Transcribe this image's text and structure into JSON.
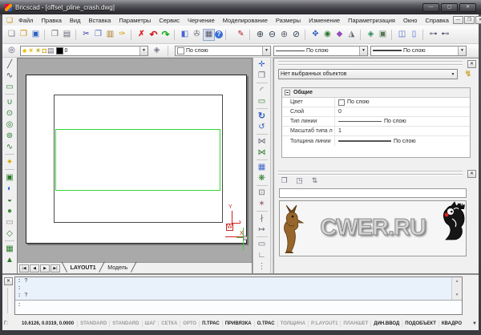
{
  "window": {
    "title": "Bricscad - [offset_pline_crash.dwg]",
    "buttons": [
      {
        "n": "minimize-button",
        "g": "—"
      },
      {
        "n": "maximize-button",
        "g": "▢"
      },
      {
        "n": "close-button",
        "g": "✕"
      }
    ]
  },
  "menu": {
    "items": [
      "Файл",
      "Правка",
      "Вид",
      "Вставка",
      "Параметры",
      "Сервис",
      "Черчение",
      "Моделирование",
      "Размеры",
      "Изменение",
      "Параметризация",
      "Окно",
      "Справка"
    ],
    "doc_icon": "❏",
    "mdi": [
      {
        "n": "mdi-minimize-button",
        "g": "—"
      },
      {
        "n": "mdi-restore-button",
        "g": "❐"
      },
      {
        "n": "mdi-close-button",
        "g": "✕"
      }
    ]
  },
  "toolbar1": {
    "icons": [
      {
        "n": "new-file-icon",
        "g": "❏",
        "s": "color:#778"
      },
      {
        "n": "open-file-icon",
        "g": "❒",
        "s": "color:#c88a00"
      },
      {
        "n": "save-icon",
        "g": "▣",
        "s": "color:#2f5fc0"
      },
      {
        "n": "separator",
        "g": "",
        "s": "width:3px;height:13px;border-left:1px solid #c6c6c6;margin:0 3px"
      },
      {
        "n": "print-preview-icon",
        "g": "❐",
        "s": "color:#667"
      },
      {
        "n": "print-icon",
        "g": "▤",
        "s": "color:#667"
      },
      {
        "n": "separator",
        "g": "",
        "s": "width:3px;height:13px;border-left:1px solid #c6c6c6;margin:0 3px"
      },
      {
        "n": "cut-icon",
        "g": "✂",
        "s": "color:#33a"
      },
      {
        "n": "copy-icon",
        "g": "❐",
        "s": "color:#46c"
      },
      {
        "n": "paste-icon",
        "g": "▥",
        "s": "color:#a72"
      },
      {
        "n": "format-brush-icon",
        "g": "✑",
        "s": "color:#c8a000"
      },
      {
        "n": "separator",
        "g": "",
        "s": "width:3px;height:13px;border-left:1px solid #c6c6c6;margin:0 3px"
      },
      {
        "n": "delete-icon",
        "g": "✗",
        "s": "color:#d22;font-weight:bold"
      },
      {
        "n": "undo-icon",
        "g": "↶",
        "s": "color:#c11;font-weight:bold;font-size:12px"
      },
      {
        "n": "redo-icon",
        "g": "↷",
        "s": "color:#1a1;font-weight:bold;font-size:12px"
      },
      {
        "n": "separator",
        "g": "",
        "s": "width:3px;height:13px;border-left:1px solid #c6c6c6;margin:0 3px"
      },
      {
        "n": "drawing-explorer-icon",
        "g": "◧",
        "s": "color:#46c"
      },
      {
        "n": "settings-icon",
        "g": "✇",
        "s": "color:#667"
      },
      {
        "n": "calculator-icon",
        "g": "▦",
        "s": "color:#556;background:#d9e2f1;border:1px solid #93a7c7"
      },
      {
        "n": "help-icon",
        "g": "?",
        "s": "background:#3a6fd8;color:#fff;border-radius:50%;width:10px;height:10px;line-height:10px;font-size:8px;font-weight:bold;flex:none;display:block;text-align:center"
      },
      {
        "n": "separator",
        "g": "",
        "s": "width:9px;height:13px;border-left:1px solid #c6c6c6;margin:0 3px"
      },
      {
        "n": "redline-icon",
        "g": "✎",
        "s": "color:#b22"
      },
      {
        "n": "separator",
        "g": "",
        "s": "width:3px;height:13px;border-left:1px solid #c6c6c6;margin:0 3px"
      },
      {
        "n": "zoom-in-icon",
        "g": "⊕",
        "s": "color:#345;font-size:11px"
      },
      {
        "n": "zoom-out-icon",
        "g": "⊖",
        "s": "color:#345;font-size:11px"
      },
      {
        "n": "zoom-window-icon",
        "g": "⊕",
        "s": "color:#667;font-size:11px"
      },
      {
        "n": "zoom-previous-icon",
        "g": "⊘",
        "s": "color:#345;font-size:11px"
      },
      {
        "n": "separator",
        "g": "",
        "s": "width:3px;height:13px;border-left:1px solid #c6c6c6;margin:0 3px"
      },
      {
        "n": "pan-icon",
        "g": "✥",
        "s": "color:#2f5fc0"
      },
      {
        "n": "realtime-view-icon",
        "g": "◉",
        "s": "color:#2a7a2a"
      },
      {
        "n": "render-icon",
        "g": "◆",
        "s": "color:#964bb8"
      },
      {
        "n": "shade-icon",
        "g": "◮",
        "s": "color:#667"
      },
      {
        "n": "separator",
        "g": "",
        "s": "width:3px;height:13px;border-left:1px solid #c6c6c6;margin:0 3px"
      },
      {
        "n": "ucs-icon",
        "g": "◈",
        "s": "color:#2a8a5a"
      },
      {
        "n": "named-views-icon",
        "g": "▣",
        "s": "color:#575"
      },
      {
        "n": "separator",
        "g": "",
        "s": "width:3px;height:13px;border-left:1px solid #c6c6c6;margin:0 3px"
      },
      {
        "n": "split-window-icon",
        "g": "◫",
        "s": "color:#46c"
      },
      {
        "n": "single-window-icon",
        "g": "▯",
        "s": "color:#46c"
      },
      {
        "n": "separator",
        "g": "",
        "s": "width:3px;height:13px;border-left:1px solid #c6c6c6;margin:0 3px"
      },
      {
        "n": "link-icon",
        "g": "⊶",
        "s": "color:#557"
      },
      {
        "n": "unlink-icon",
        "g": "⊷",
        "s": "color:#557"
      }
    ]
  },
  "toolbar2": {
    "layer_explorer_icon": "◎",
    "layer_combo": {
      "value": "0",
      "icons": [
        {
          "n": "layer-on-icon",
          "g": "●",
          "s": "color:#f5c400;text-shadow:0 0 1px #a87800"
        },
        {
          "n": "layer-freeze-icon",
          "g": "☀",
          "s": "color:#e0b400"
        },
        {
          "n": "layer-freeze-vp-icon",
          "g": "☀",
          "s": "color:#b0a000"
        },
        {
          "n": "layer-lock-icon",
          "g": "◘",
          "s": "color:#c9a00a"
        },
        {
          "n": "layer-print-icon",
          "g": "▤",
          "s": "color:#667"
        }
      ]
    },
    "layers_manager_icon": "◈",
    "color_combo": {
      "value": "По слою"
    },
    "linetype_combo": {
      "value": "По слою"
    },
    "lineweight_combo": {
      "value": "По слою"
    }
  },
  "left_toolbar": {
    "icons": [
      {
        "n": "line-tool-icon",
        "g": "╱",
        "s": "color:#444"
      },
      {
        "n": "arc-tool-icon",
        "g": "∿",
        "s": "color:#444"
      },
      {
        "n": "polyline-tool-icon",
        "g": "▭",
        "s": "color:#2a7a2a"
      },
      {
        "n": "separator",
        "g": "",
        "s": "width:12px;height:3px;border-top:1px solid #c6c6c6;margin:1px 0"
      },
      {
        "n": "curve-tool-icon",
        "g": "∪",
        "s": "color:#2a7a2a"
      },
      {
        "n": "circle-tool-icon",
        "g": "⊙",
        "s": "color:#2a7a2a"
      },
      {
        "n": "donut-tool-icon",
        "g": "◎",
        "s": "color:#2a7a2a"
      },
      {
        "n": "ellipse-tool-icon",
        "g": "⊚",
        "s": "color:#2a7a2a"
      },
      {
        "n": "spline-tool-icon",
        "g": "∿",
        "s": "color:#2a7a2a"
      },
      {
        "n": "separator",
        "g": "",
        "s": "width:12px;height:3px;border-top:1px solid #c6c6c6;margin:1px 0"
      },
      {
        "n": "point-tool-icon",
        "g": "✦",
        "s": "color:#d4a800"
      },
      {
        "n": "separator",
        "g": "",
        "s": "width:12px;height:3px;border-top:1px solid #c6c6c6;margin:1px 0"
      },
      {
        "n": "box-tool-icon",
        "g": "▣",
        "s": "color:#2a7a2a"
      },
      {
        "n": "sphere-tool-icon",
        "g": "◐",
        "s": "color:#36c"
      },
      {
        "n": "wedge-tool-icon",
        "g": "◒",
        "s": "color:#2a7a2a"
      },
      {
        "n": "cloud-tool-icon",
        "g": "●",
        "s": "color:#3a8a3a"
      },
      {
        "n": "boundary-tool-icon",
        "g": "▭",
        "s": "color:#888"
      },
      {
        "n": "polygon-tool-icon",
        "g": "◇",
        "s": "color:#2a7a2a"
      },
      {
        "n": "separator",
        "g": "",
        "s": "width:12px;height:3px;border-top:1px solid #c6c6c6;margin:1px 0"
      },
      {
        "n": "table-tool-icon",
        "g": "▦",
        "s": "color:#2a7a2a"
      },
      {
        "n": "triangle-tool-icon",
        "g": "▲",
        "s": "color:#2a7a2a"
      }
    ]
  },
  "right_toolbar": {
    "icons": [
      {
        "n": "move-icon",
        "g": "✛",
        "s": "color:#2f5fc0"
      },
      {
        "n": "copy-object-icon",
        "g": "❐",
        "s": "color:#667"
      },
      {
        "n": "separator",
        "g": "",
        "s": "width:14px;height:2px;border-top:1px solid #c6c6c6;margin:1px 0"
      },
      {
        "n": "fillet-icon",
        "g": "◜",
        "s": "color:#667;font-size:11px"
      },
      {
        "n": "chamfer-icon",
        "g": "▭",
        "s": "color:#2a7a2a"
      },
      {
        "n": "separator",
        "g": "",
        "s": "width:14px;height:2px;border-top:1px solid #c6c6c6;margin:1px 0"
      },
      {
        "n": "rotate-icon",
        "g": "↻",
        "s": "color:#2f5fc0;font-size:11px;font-weight:bold"
      },
      {
        "n": "rotate-ref-icon",
        "g": "↺",
        "s": "color:#2f5fc0"
      },
      {
        "n": "separator",
        "g": "",
        "s": "width:14px;height:2px;border-top:1px solid #c6c6c6;margin:1px 0"
      },
      {
        "n": "mirror-icon",
        "g": "⋈",
        "s": "color:#667"
      },
      {
        "n": "mirror-3d-icon",
        "g": "⋈",
        "s": "color:#2a7a2a"
      },
      {
        "n": "separator",
        "g": "",
        "s": "width:14px;height:2px;border-top:1px solid #c6c6c6;margin:1px 0"
      },
      {
        "n": "array-icon",
        "g": "▦",
        "s": "color:#46c"
      },
      {
        "n": "polar-array-icon",
        "g": "❋",
        "s": "color:#2a7a2a"
      },
      {
        "n": "separator",
        "g": "",
        "s": "width:14px;height:2px;border-top:1px solid #c6c6c6;margin:1px 0"
      },
      {
        "n": "offset-icon",
        "g": "⊡",
        "s": "color:#667"
      },
      {
        "n": "explode-icon",
        "g": "✶",
        "s": "color:#967"
      },
      {
        "n": "separator",
        "g": "",
        "s": "width:14px;height:2px;border-top:1px solid #c6c6c6;margin:1px 0"
      },
      {
        "n": "trim-icon",
        "g": "∤",
        "s": "color:#667"
      },
      {
        "n": "extend-icon",
        "g": "↦",
        "s": "color:#667"
      },
      {
        "n": "separator",
        "g": "",
        "s": "width:14px;height:2px;border-top:1px solid #c6c6c6;margin:1px 0"
      },
      {
        "n": "stretch-icon",
        "g": "▭",
        "s": "color:#667"
      },
      {
        "n": "pedit-icon",
        "g": "∟",
        "s": "color:#667"
      },
      {
        "n": "more-icon",
        "g": "⋮",
        "s": "color:#667"
      }
    ]
  },
  "properties": {
    "selection": "Нет выбранных объектов",
    "group": "Общие",
    "rows": [
      {
        "label": "Цвет",
        "value": "По слою"
      },
      {
        "label": "Слой",
        "value": "0"
      },
      {
        "label": "Тип линии",
        "value": "По слою"
      },
      {
        "label": "Масштаб типа л",
        "value": "1"
      },
      {
        "label": "Толщина линии",
        "value": "По слою"
      }
    ]
  },
  "structure": {
    "icons": [
      {
        "n": "structure-tree-icon",
        "g": "❐",
        "s": "color:#667"
      },
      {
        "n": "structure-settings-icon",
        "g": "◳",
        "s": "color:#667"
      },
      {
        "n": "structure-sort-icon",
        "g": "⇅",
        "s": "color:#667"
      }
    ],
    "search_value": "",
    "watermark": "CWER.RU"
  },
  "tabs": {
    "nav": [
      {
        "n": "first-layout-button",
        "g": "|◀"
      },
      {
        "n": "prev-layout-button",
        "g": "◀"
      },
      {
        "n": "next-layout-button",
        "g": "▶"
      },
      {
        "n": "last-layout-button",
        "g": "▶|"
      }
    ],
    "edge_start": "╲",
    "edge_sep": "╱",
    "items": [
      "LAYOUT1",
      "Модель"
    ]
  },
  "command": {
    "history": [
      ": ?",
      ":",
      ": ?"
    ],
    "prompt": ":"
  },
  "status": {
    "left": "Г:",
    "coords": "10.6126, 0.0319, 0.0000",
    "items": [
      {
        "t": "STANDARD",
        "c": "sbi"
      },
      {
        "t": "STANDARD",
        "c": "sbi"
      },
      {
        "t": "ШАГ",
        "c": "sbi"
      },
      {
        "t": "СЕТКА",
        "c": "sbi"
      },
      {
        "t": "ОРТО",
        "c": "sbi"
      },
      {
        "t": "П.ТРАС",
        "c": "sbi on"
      },
      {
        "t": "ПРИВЯЗКА",
        "c": "sbi on"
      },
      {
        "t": "О.ТРАС",
        "c": "sbi on"
      },
      {
        "t": "ТОЛЩИНА",
        "c": "sbi"
      },
      {
        "t": "P:LAYOUT1",
        "c": "sbi"
      },
      {
        "t": "ПЛАНШЕТ",
        "c": "sbi"
      },
      {
        "t": "ДИН.ВВОД",
        "c": "sbi on"
      },
      {
        "t": "ПОДОБЪЕКТ",
        "c": "sbi on"
      },
      {
        "t": "КВАДРО",
        "c": "sbi on"
      }
    ],
    "more": "▾"
  }
}
